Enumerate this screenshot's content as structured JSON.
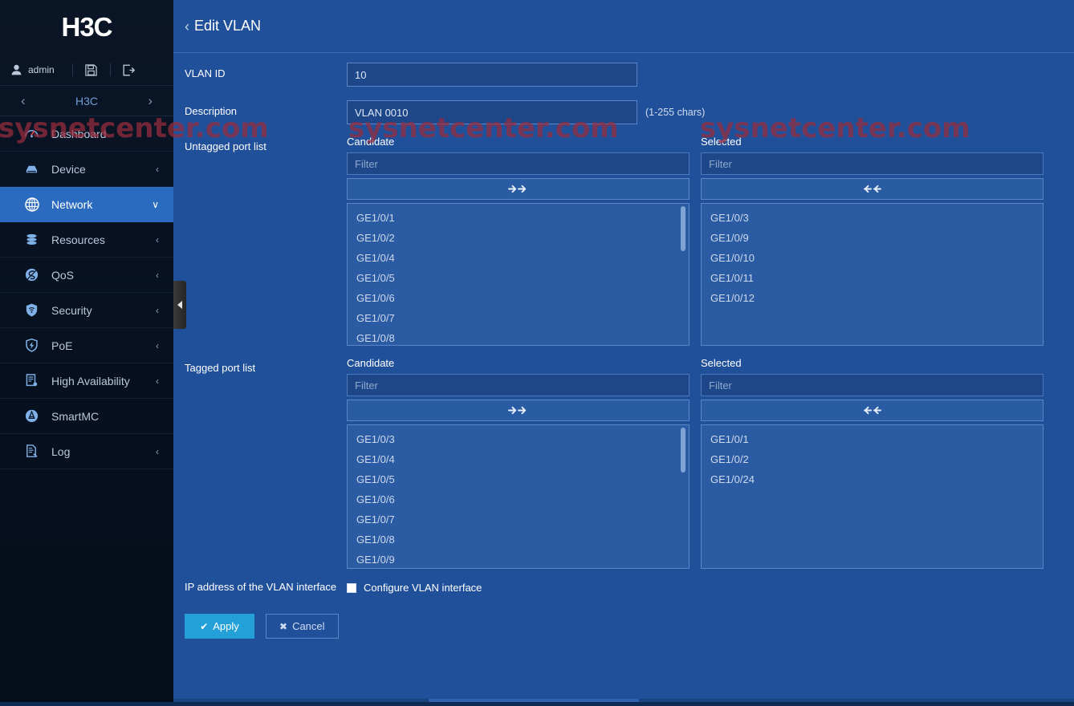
{
  "brand": {
    "logo_text": "H3C"
  },
  "sidebar": {
    "user": {
      "name": "admin",
      "user_icon": "user-icon",
      "save_icon": "save-icon",
      "logout_icon": "logout-icon"
    },
    "device_selector": {
      "prev": "‹",
      "name": "H3C",
      "next": "›"
    },
    "items": [
      {
        "label": "Dashboard",
        "icon": "gauge-icon",
        "chevron": "",
        "active": false
      },
      {
        "label": "Device",
        "icon": "device-icon",
        "chevron": "‹",
        "active": false
      },
      {
        "label": "Network",
        "icon": "globe-icon",
        "chevron": "∨",
        "active": true
      },
      {
        "label": "Resources",
        "icon": "database-icon",
        "chevron": "‹",
        "active": false
      },
      {
        "label": "QoS",
        "icon": "qos-icon",
        "chevron": "‹",
        "active": false
      },
      {
        "label": "Security",
        "icon": "shield-icon",
        "chevron": "‹",
        "active": false
      },
      {
        "label": "PoE",
        "icon": "poe-icon",
        "chevron": "‹",
        "active": false
      },
      {
        "label": "High Availability",
        "icon": "ha-icon",
        "chevron": "‹",
        "active": false
      },
      {
        "label": "SmartMC",
        "icon": "smartmc-icon",
        "chevron": "",
        "active": false
      },
      {
        "label": "Log",
        "icon": "log-icon",
        "chevron": "‹",
        "active": false
      }
    ],
    "collapse_handle": "collapse-sidebar-handle"
  },
  "page": {
    "back_chevron": "‹",
    "title": "Edit VLAN"
  },
  "form": {
    "vlan_id": {
      "label": "VLAN ID",
      "value": "10",
      "placeholder": ""
    },
    "description": {
      "label": "Description",
      "value": "VLAN 0010",
      "placeholder": "",
      "hint": "(1-255 chars)"
    },
    "untagged": {
      "label": "Untagged port list",
      "candidate": {
        "heading": "Candidate",
        "filter_placeholder": "Filter",
        "filter_value": "",
        "transfer_button": "»",
        "items": [
          "GE1/0/1",
          "GE1/0/2",
          "GE1/0/4",
          "GE1/0/5",
          "GE1/0/6",
          "GE1/0/7",
          "GE1/0/8"
        ],
        "has_scrollbar": true
      },
      "selected": {
        "heading": "Selected",
        "filter_placeholder": "Filter",
        "filter_value": "",
        "transfer_button": "«",
        "items": [
          "GE1/0/3",
          "GE1/0/9",
          "GE1/0/10",
          "GE1/0/11",
          "GE1/0/12"
        ],
        "has_scrollbar": false
      }
    },
    "tagged": {
      "label": "Tagged port list",
      "candidate": {
        "heading": "Candidate",
        "filter_placeholder": "Filter",
        "filter_value": "",
        "transfer_button": "»",
        "items": [
          "GE1/0/3",
          "GE1/0/4",
          "GE1/0/5",
          "GE1/0/6",
          "GE1/0/7",
          "GE1/0/8",
          "GE1/0/9"
        ],
        "has_scrollbar": true
      },
      "selected": {
        "heading": "Selected",
        "filter_placeholder": "Filter",
        "filter_value": "",
        "transfer_button": "«",
        "items": [
          "GE1/0/1",
          "GE1/0/2",
          "GE1/0/24"
        ],
        "has_scrollbar": false
      }
    },
    "vlan_interface": {
      "label": "IP address of the VLAN interface",
      "checkbox_label": "Configure VLAN interface",
      "checked": false
    },
    "buttons": {
      "apply": {
        "icon": "✔",
        "label": "Apply"
      },
      "cancel": {
        "icon": "✖",
        "label": "Cancel"
      }
    }
  },
  "watermark": {
    "text": "sysnetcenter.com",
    "color": "#9a2d3e"
  },
  "colors": {
    "main_bg": "#21509b",
    "sidebar_bg": "#0a1526",
    "accent_active": "#2a6bbf",
    "apply_button": "#23a0d8",
    "input_bg": "#1d4789",
    "list_bg": "#2b5ca3",
    "border": "#5d86c4"
  }
}
